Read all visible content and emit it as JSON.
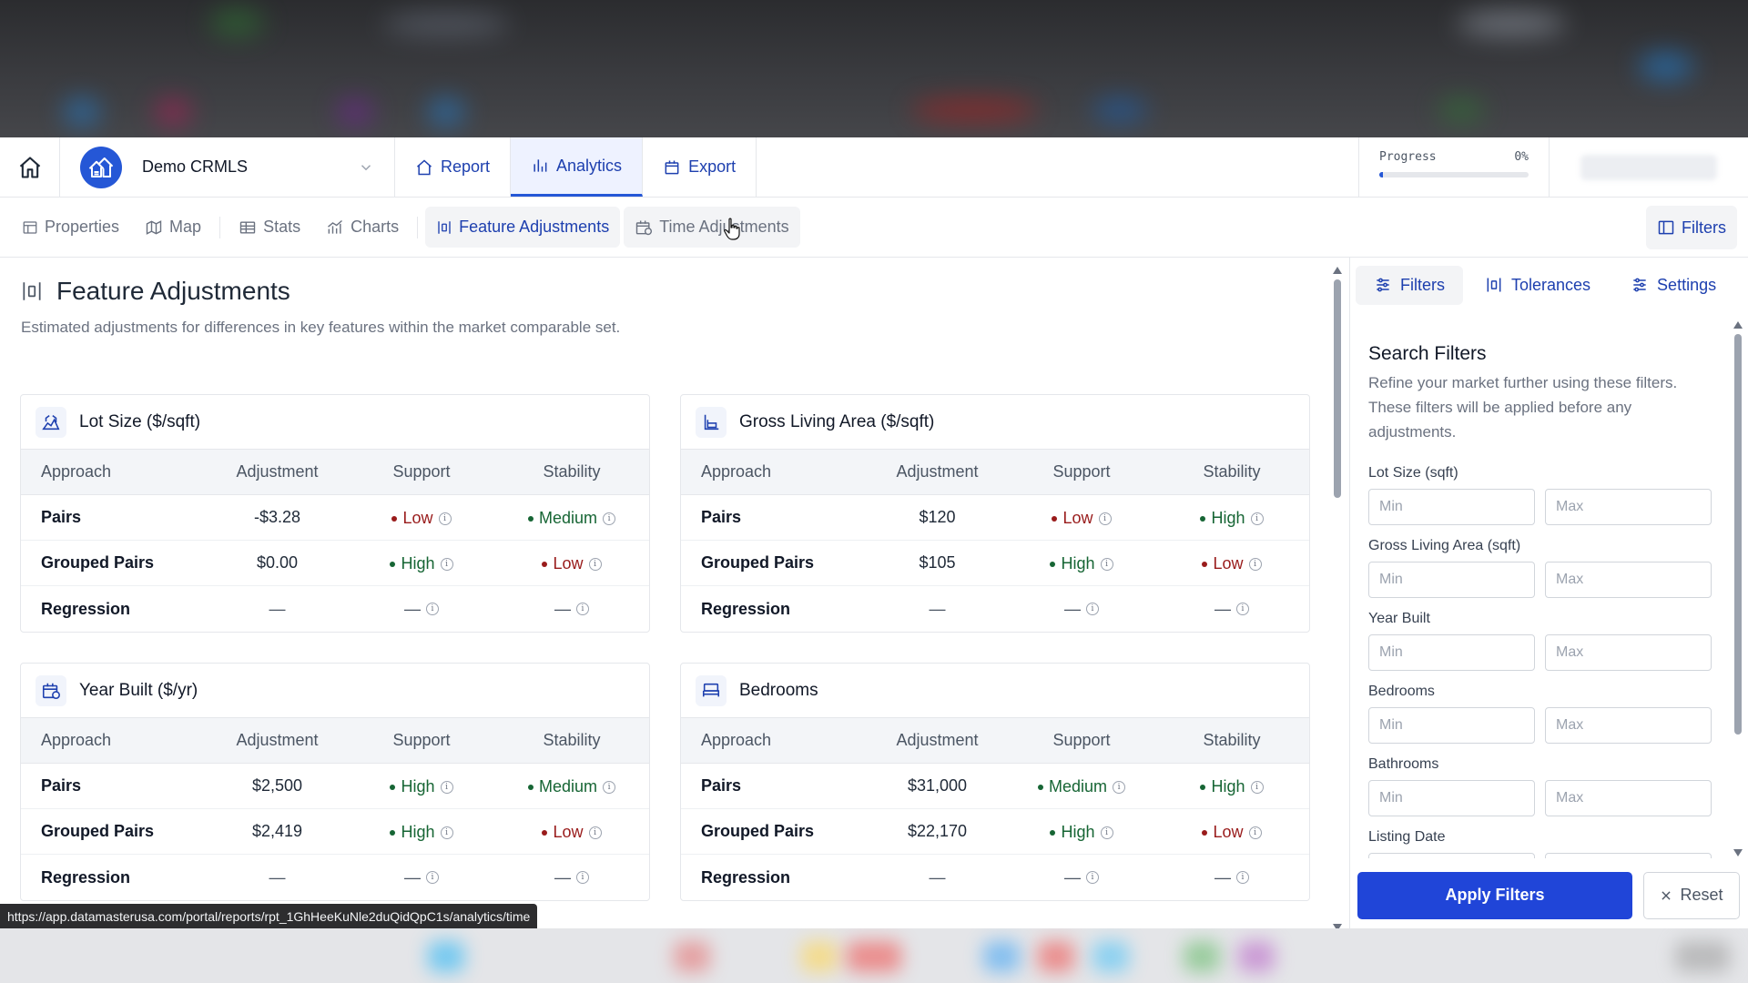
{
  "app": {
    "org_name": "Demo CRMLS",
    "nav_tabs": [
      {
        "label": "Report",
        "icon": "home-icon",
        "active": false
      },
      {
        "label": "Analytics",
        "icon": "bar-chart-icon",
        "active": true
      },
      {
        "label": "Export",
        "icon": "export-icon",
        "active": false
      }
    ],
    "progress": {
      "label": "Progress",
      "value_text": "0%",
      "value": 0
    }
  },
  "subnav": {
    "items": [
      {
        "label": "Properties",
        "icon": "table-icon"
      },
      {
        "label": "Map",
        "icon": "map-icon"
      },
      {
        "label": "Stats",
        "icon": "stats-icon"
      },
      {
        "label": "Charts",
        "icon": "chart-icon"
      },
      {
        "label": "Feature Adjustments",
        "icon": "adjustments-icon"
      },
      {
        "label": "Time Adjustments",
        "icon": "calendar-icon"
      }
    ],
    "active": "Feature Adjustments",
    "filters_label": "Filters"
  },
  "page": {
    "title": "Feature Adjustments",
    "description": "Estimated adjustments for differences in key features within the market comparable set."
  },
  "table_headers": [
    "Approach",
    "Adjustment",
    "Support",
    "Stability"
  ],
  "cards": [
    {
      "title": "Lot Size ($/sqft)",
      "icon": "lot-size-icon",
      "rows": [
        {
          "approach": "Pairs",
          "adjustment": "-$3.28",
          "support": "Low",
          "stability": "Medium"
        },
        {
          "approach": "Grouped Pairs",
          "adjustment": "$0.00",
          "support": "High",
          "stability": "Low"
        },
        {
          "approach": "Regression",
          "adjustment": "—",
          "support": "—",
          "stability": "—"
        }
      ]
    },
    {
      "title": "Gross Living Area ($/sqft)",
      "icon": "living-area-icon",
      "rows": [
        {
          "approach": "Pairs",
          "adjustment": "$120",
          "support": "Low",
          "stability": "High"
        },
        {
          "approach": "Grouped Pairs",
          "adjustment": "$105",
          "support": "High",
          "stability": "Low"
        },
        {
          "approach": "Regression",
          "adjustment": "—",
          "support": "—",
          "stability": "—"
        }
      ]
    },
    {
      "title": "Year Built ($/yr)",
      "icon": "year-built-icon",
      "rows": [
        {
          "approach": "Pairs",
          "adjustment": "$2,500",
          "support": "High",
          "stability": "Medium"
        },
        {
          "approach": "Grouped Pairs",
          "adjustment": "$2,419",
          "support": "High",
          "stability": "Low"
        },
        {
          "approach": "Regression",
          "adjustment": "—",
          "support": "—",
          "stability": "—"
        }
      ]
    },
    {
      "title": "Bedrooms",
      "icon": "bed-icon",
      "rows": [
        {
          "approach": "Pairs",
          "adjustment": "$31,000",
          "support": "Medium",
          "stability": "High"
        },
        {
          "approach": "Grouped Pairs",
          "adjustment": "$22,170",
          "support": "High",
          "stability": "Low"
        },
        {
          "approach": "Regression",
          "adjustment": "—",
          "support": "—",
          "stability": "—"
        }
      ]
    }
  ],
  "panel": {
    "tabs": [
      {
        "label": "Filters",
        "icon": "sliders-icon"
      },
      {
        "label": "Tolerances",
        "icon": "tolerances-icon"
      },
      {
        "label": "Settings",
        "icon": "settings-sliders-icon"
      }
    ],
    "title": "Search Filters",
    "description": "Refine your market further using these filters. These filters will be applied before any adjustments.",
    "fields": [
      {
        "label": "Lot Size (sqft)",
        "min_placeholder": "Min",
        "max_placeholder": "Max"
      },
      {
        "label": "Gross Living Area (sqft)",
        "min_placeholder": "Min",
        "max_placeholder": "Max"
      },
      {
        "label": "Year Built",
        "min_placeholder": "Min",
        "max_placeholder": "Max"
      },
      {
        "label": "Bedrooms",
        "min_placeholder": "Min",
        "max_placeholder": "Max"
      },
      {
        "label": "Bathrooms",
        "min_placeholder": "Min",
        "max_placeholder": "Max"
      },
      {
        "label": "Listing Date",
        "min_placeholder": "",
        "max_placeholder": ""
      }
    ],
    "apply_label": "Apply Filters",
    "reset_label": "Reset"
  },
  "status_url": "https://app.datamasterusa.com/portal/reports/rpt_1GhHeeKuNle2duQidQpC1s/analytics/time",
  "colors": {
    "accent": "#2557d6",
    "low": "#991b1b",
    "high": "#166534"
  }
}
